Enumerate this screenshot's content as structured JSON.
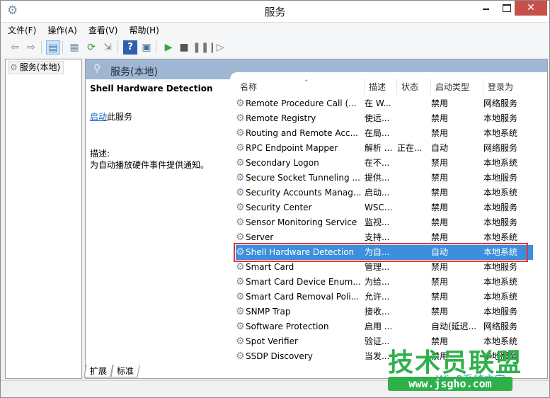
{
  "window": {
    "title": "服务",
    "app_icon": "gear-icon",
    "controls": {
      "minimize": "minimize",
      "maximize": "maximize",
      "close": "✕"
    },
    "close_color": "#c7504a"
  },
  "menubar": {
    "items": [
      "文件(F)",
      "操作(A)",
      "查看(V)",
      "帮助(H)"
    ]
  },
  "toolbar": {
    "buttons": [
      {
        "icon": "back-arrow-icon",
        "glyph": "⇦"
      },
      {
        "icon": "forward-arrow-icon",
        "glyph": "⇨"
      },
      {
        "icon": "show-hide-console-tree-icon",
        "glyph": "▤",
        "active": true
      },
      {
        "icon": "properties-icon",
        "glyph": "▦"
      },
      {
        "icon": "refresh-icon",
        "glyph": "⟳"
      },
      {
        "icon": "export-list-icon",
        "glyph": "⇲"
      },
      {
        "icon": "help-icon",
        "glyph": "?"
      },
      {
        "icon": "action-pane-icon",
        "glyph": "▣"
      },
      {
        "icon": "start-service-icon",
        "glyph": "▶"
      },
      {
        "icon": "stop-service-icon",
        "glyph": "■"
      },
      {
        "icon": "pause-service-icon",
        "glyph": "❚❚"
      },
      {
        "icon": "resume-service-icon",
        "glyph": "❙▷"
      }
    ]
  },
  "tree": {
    "items": [
      {
        "label": "服务(本地)",
        "icon": "gear-icon"
      }
    ]
  },
  "main": {
    "header_title": "服务(本地)",
    "detail": {
      "service_name": "Shell Hardware Detection",
      "start_link": "启动",
      "start_suffix": "此服务",
      "description_label": "描述:",
      "description": "为自动播放硬件事件提供通知。"
    },
    "columns": [
      "名称",
      "描述",
      "状态",
      "启动类型",
      "登录为"
    ],
    "rows": [
      {
        "name": "Remote Procedure Call (...",
        "desc": "在 W...",
        "status": "",
        "startup": "禁用",
        "logon": "网络服务"
      },
      {
        "name": "Remote Registry",
        "desc": "使远...",
        "status": "",
        "startup": "禁用",
        "logon": "本地服务"
      },
      {
        "name": "Routing and Remote Acc...",
        "desc": "在局...",
        "status": "",
        "startup": "禁用",
        "logon": "本地系统"
      },
      {
        "name": "RPC Endpoint Mapper",
        "desc": "解析 ...",
        "status": "正在...",
        "startup": "自动",
        "logon": "网络服务"
      },
      {
        "name": "Secondary Logon",
        "desc": "在不...",
        "status": "",
        "startup": "禁用",
        "logon": "本地系统"
      },
      {
        "name": "Secure Socket Tunneling ...",
        "desc": "提供...",
        "status": "",
        "startup": "禁用",
        "logon": "本地服务"
      },
      {
        "name": "Security Accounts Manag...",
        "desc": "启动...",
        "status": "",
        "startup": "禁用",
        "logon": "本地系统"
      },
      {
        "name": "Security Center",
        "desc": "WSC...",
        "status": "",
        "startup": "禁用",
        "logon": "本地服务"
      },
      {
        "name": "Sensor Monitoring Service",
        "desc": "监视...",
        "status": "",
        "startup": "禁用",
        "logon": "本地服务"
      },
      {
        "name": "Server",
        "desc": "支持...",
        "status": "",
        "startup": "禁用",
        "logon": "本地系统"
      },
      {
        "name": "Shell Hardware Detection",
        "desc": "为自...",
        "status": "",
        "startup": "自动",
        "logon": "本地系统",
        "selected": true
      },
      {
        "name": "Smart Card",
        "desc": "管理...",
        "status": "",
        "startup": "禁用",
        "logon": "本地服务"
      },
      {
        "name": "Smart Card Device Enum...",
        "desc": "为给...",
        "status": "",
        "startup": "禁用",
        "logon": "本地系统"
      },
      {
        "name": "Smart Card Removal Poli...",
        "desc": "允许...",
        "status": "",
        "startup": "禁用",
        "logon": "本地系统"
      },
      {
        "name": "SNMP Trap",
        "desc": "接收...",
        "status": "",
        "startup": "禁用",
        "logon": "本地服务"
      },
      {
        "name": "Software Protection",
        "desc": "启用 ...",
        "status": "",
        "startup": "自动(延迟...",
        "logon": "网络服务"
      },
      {
        "name": "Spot Verifier",
        "desc": "验证...",
        "status": "",
        "startup": "禁用",
        "logon": "本地系统"
      },
      {
        "name": "SSDP Discovery",
        "desc": "当发...",
        "status": "",
        "startup": "禁用",
        "logon": "本地服务"
      }
    ],
    "selection_color": "#3d8fdb",
    "highlight_outline_color": "#e0353a"
  },
  "tabs": [
    "扩展",
    "标准"
  ],
  "watermark": {
    "title": "技术员联盟",
    "subtitle": "Win8系统之家",
    "url": "www.jsgho.com",
    "color": "#2eb14b"
  }
}
